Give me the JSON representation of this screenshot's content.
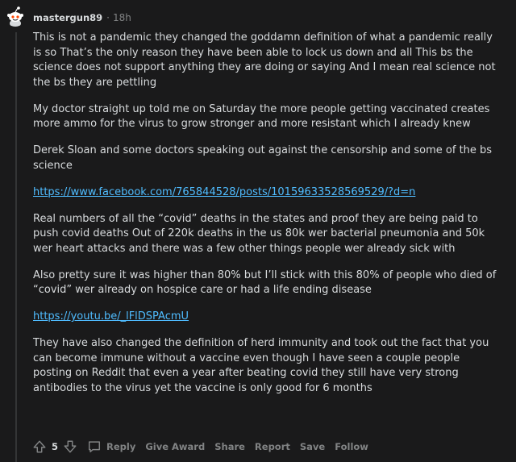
{
  "comment": {
    "username": "mastergun89",
    "separator": "·",
    "timestamp": "18h",
    "paragraphs": [
      "This is not a pandemic they changed the goddamn definition of what a pandemic really is so That’s the only reason they have been able to lock us down and all This bs the science does not support anything they are doing or saying And I mean real science not the bs they are pettling",
      "My doctor straight up told me on Saturday the more people getting vaccinated creates more ammo for the virus to grow stronger and more resistant which I already knew",
      "Derek Sloan and some doctors speaking out against the censorship and some of the bs science"
    ],
    "link1": "https://www.facebook.com/765844528/posts/10159633528569529/?d=n",
    "paragraphs2": [
      "Real numbers of all the “covid” deaths in the states and proof they are being paid to push covid deaths Out of 220k deaths in the us 80k wer bacterial pneumonia and 50k wer heart attacks and there was a few other things people wer already sick with",
      "Also pretty sure it was higher than 80% but I’ll stick with this 80% of people who died of “covid” wer already on hospice care or had a life ending disease"
    ],
    "link2": "https://youtu.be/_lFlDSPAcmU",
    "paragraph_last": "They have also changed the definition of herd immunity and took out the fact that you can become immune without a vaccine even though I have seen a couple people posting on Reddit that even a year after beating covid they still have very strong antibodies to the virus yet the vaccine is only good for 6 months"
  },
  "actions": {
    "score": "5",
    "upvote_icon": "upvote-arrow-icon",
    "downvote_icon": "downvote-arrow-icon",
    "reply": "Reply",
    "give_award": "Give Award",
    "share": "Share",
    "report": "Report",
    "save": "Save",
    "follow": "Follow"
  },
  "colors": {
    "background": "#1a1a1b",
    "text": "#d7dadc",
    "muted": "#818384",
    "link": "#4fbcff"
  }
}
